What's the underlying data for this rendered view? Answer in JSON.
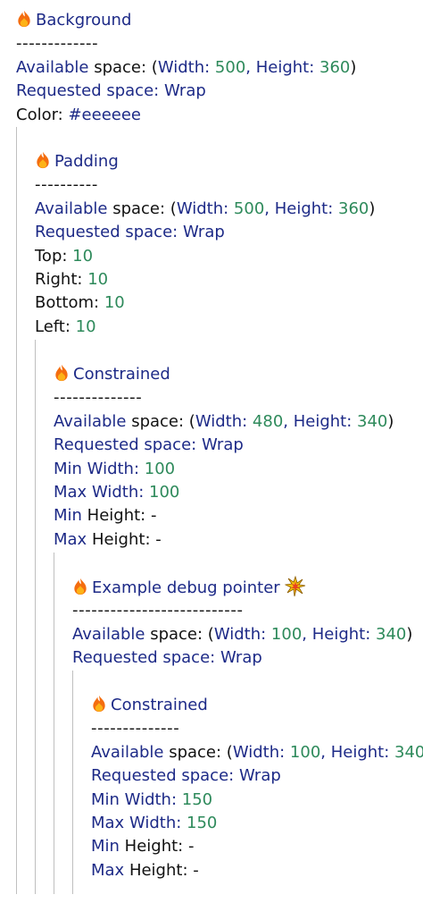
{
  "nodes": [
    {
      "icon": "fire-icon",
      "title": "Background",
      "separator": "-------------",
      "available_prefix": "Available",
      "available_space_label": " space: (",
      "width_label": "Width: ",
      "width_value": "500",
      "height_label": ", Height: ",
      "height_value": "360",
      "available_suffix": ")",
      "requested_prefix": "Requested",
      "requested_space_label": " space: Wrap",
      "color_label": "Color: ",
      "color_value": "#eeeeee"
    },
    {
      "icon": "fire-icon",
      "title": "Padding",
      "separator": "----------",
      "available_prefix": "Available",
      "available_space_label": " space: (",
      "width_label": "Width: ",
      "width_value": "500",
      "height_label": ", Height: ",
      "height_value": "360",
      "available_suffix": ")",
      "requested_prefix": "Requested",
      "requested_space_label": " space: Wrap",
      "top_label": "Top: ",
      "top_value": "10",
      "right_label": "Right: ",
      "right_value": "10",
      "bottom_label": "Bottom: ",
      "bottom_value": "10",
      "left_label": "Left: ",
      "left_value": "10"
    },
    {
      "icon": "fire-icon",
      "title": "Constrained",
      "separator": "--------------",
      "available_prefix": "Available",
      "available_space_label": " space: (",
      "width_label": "Width: ",
      "width_value": "480",
      "height_label": ", Height: ",
      "height_value": "340",
      "available_suffix": ")",
      "requested_prefix": "Requested",
      "requested_space_label": " space: Wrap",
      "min_width_prefix": "Min",
      "min_width_label": " Width: ",
      "min_width_value": "100",
      "max_width_prefix": "Max",
      "max_width_label": " Width: ",
      "max_width_value": "100",
      "min_height_prefix": "Min",
      "min_height_label": " Height: -",
      "max_height_prefix": "Max",
      "max_height_label": " Height: -"
    },
    {
      "icon": "fire-icon",
      "title": "Example debug pointer",
      "trailing_icon": "burst-icon",
      "separator": "---------------------------",
      "available_prefix": "Available",
      "available_space_label": " space: (",
      "width_label": "Width: ",
      "width_value": "100",
      "height_label": ", Height: ",
      "height_value": "340",
      "available_suffix": ")",
      "requested_prefix": "Requested",
      "requested_space_label": " space: Wrap"
    },
    {
      "icon": "fire-icon",
      "title": "Constrained",
      "separator": "--------------",
      "available_prefix": "Available",
      "available_space_label": " space: (",
      "width_label": "Width: ",
      "width_value": "100",
      "height_label": ", Height: ",
      "height_value": "340",
      "available_suffix": ")",
      "requested_prefix": "Requested",
      "requested_space_label": " space: Wrap",
      "min_width_prefix": "Min",
      "min_width_label": " Width: ",
      "min_width_value": "150",
      "max_width_prefix": "Max",
      "max_width_label": " Width: ",
      "max_width_value": "150",
      "min_height_prefix": "Min",
      "min_height_label": " Height: -",
      "max_height_prefix": "Max",
      "max_height_label": " Height: -"
    }
  ]
}
